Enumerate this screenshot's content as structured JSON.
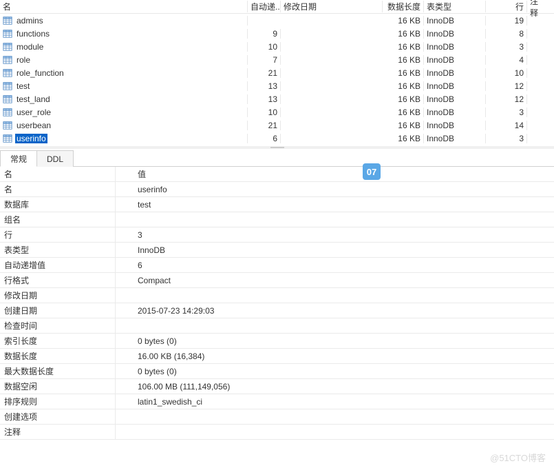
{
  "table_list": {
    "headers": {
      "name": "名",
      "auto_inc": "自动递...",
      "modify_date": "修改日期",
      "data_length": "数据长度",
      "table_type": "表类型",
      "rows": "行",
      "comment": "注释"
    },
    "rows": [
      {
        "name": "admins",
        "auto_inc": "",
        "modify_date": "",
        "data_length": "16 KB",
        "table_type": "InnoDB",
        "rows": "19",
        "comment": ""
      },
      {
        "name": "functions",
        "auto_inc": "9",
        "modify_date": "",
        "data_length": "16 KB",
        "table_type": "InnoDB",
        "rows": "8",
        "comment": ""
      },
      {
        "name": "module",
        "auto_inc": "10",
        "modify_date": "",
        "data_length": "16 KB",
        "table_type": "InnoDB",
        "rows": "3",
        "comment": ""
      },
      {
        "name": "role",
        "auto_inc": "7",
        "modify_date": "",
        "data_length": "16 KB",
        "table_type": "InnoDB",
        "rows": "4",
        "comment": ""
      },
      {
        "name": "role_function",
        "auto_inc": "21",
        "modify_date": "",
        "data_length": "16 KB",
        "table_type": "InnoDB",
        "rows": "10",
        "comment": ""
      },
      {
        "name": "test",
        "auto_inc": "13",
        "modify_date": "",
        "data_length": "16 KB",
        "table_type": "InnoDB",
        "rows": "12",
        "comment": ""
      },
      {
        "name": "test_land",
        "auto_inc": "13",
        "modify_date": "",
        "data_length": "16 KB",
        "table_type": "InnoDB",
        "rows": "12",
        "comment": ""
      },
      {
        "name": "user_role",
        "auto_inc": "10",
        "modify_date": "",
        "data_length": "16 KB",
        "table_type": "InnoDB",
        "rows": "3",
        "comment": ""
      },
      {
        "name": "userbean",
        "auto_inc": "21",
        "modify_date": "",
        "data_length": "16 KB",
        "table_type": "InnoDB",
        "rows": "14",
        "comment": ""
      },
      {
        "name": "userinfo",
        "auto_inc": "6",
        "modify_date": "",
        "data_length": "16 KB",
        "table_type": "InnoDB",
        "rows": "3",
        "comment": "",
        "selected": true
      }
    ]
  },
  "tabs": {
    "general": "常规",
    "ddl": "DDL"
  },
  "props": {
    "header_key": "名",
    "header_val": "值",
    "items": [
      {
        "key": "名",
        "val": "userinfo"
      },
      {
        "key": "数据库",
        "val": "test"
      },
      {
        "key": "组名",
        "val": ""
      },
      {
        "key": "行",
        "val": "3"
      },
      {
        "key": "表类型",
        "val": "InnoDB"
      },
      {
        "key": "自动递增值",
        "val": "6"
      },
      {
        "key": "行格式",
        "val": "Compact"
      },
      {
        "key": "修改日期",
        "val": ""
      },
      {
        "key": "创建日期",
        "val": "2015-07-23 14:29:03"
      },
      {
        "key": "检查时间",
        "val": ""
      },
      {
        "key": "索引长度",
        "val": "0 bytes (0)"
      },
      {
        "key": "数据长度",
        "val": "16.00 KB (16,384)"
      },
      {
        "key": "最大数据长度",
        "val": "0 bytes (0)"
      },
      {
        "key": "数据空闲",
        "val": "106.00 MB (111,149,056)"
      },
      {
        "key": "排序规则",
        "val": "latin1_swedish_ci"
      },
      {
        "key": "创建选项",
        "val": ""
      },
      {
        "key": "注释",
        "val": ""
      }
    ]
  },
  "badge": "07",
  "watermark": "@51CTO博客"
}
